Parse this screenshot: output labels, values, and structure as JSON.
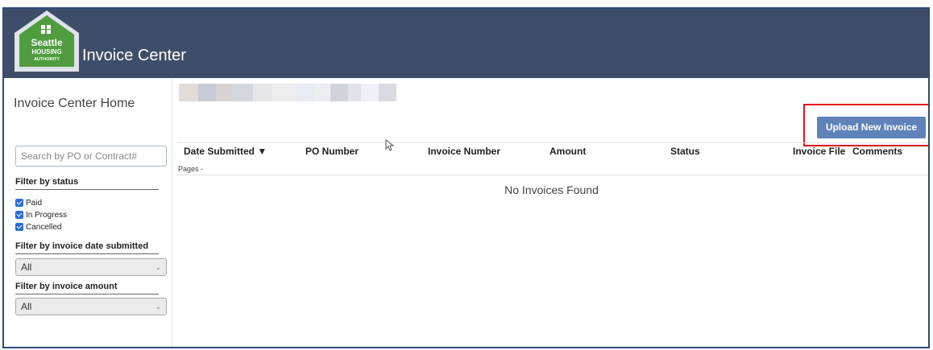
{
  "header": {
    "title": "Invoice Center",
    "logo_lines": [
      "Seattle",
      "HOUSING",
      "AUTHORITY"
    ]
  },
  "sidebar": {
    "home_link": "Invoice Center Home",
    "search_placeholder": "Search by PO or Contract#",
    "status_filter": {
      "heading": "Filter by status",
      "options": [
        {
          "label": "Paid",
          "checked": true
        },
        {
          "label": "In Progress",
          "checked": true
        },
        {
          "label": "Cancelled",
          "checked": true
        }
      ]
    },
    "date_filter": {
      "heading": "Filter by invoice date submitted",
      "value": "All"
    },
    "amount_filter": {
      "heading": "Filter by invoice amount",
      "value": "All"
    }
  },
  "main": {
    "upload_button": "Upload New Invoice",
    "columns": [
      "Date Submitted",
      "PO Number",
      "Invoice Number",
      "Amount",
      "Status",
      "Invoice File",
      "Comments"
    ],
    "sort_indicator": "▼",
    "pages_label": "Pages -",
    "empty_message": "No Invoices Found"
  },
  "colors": {
    "header_bg": "#3f4e68",
    "button_bg": "#5f82b8",
    "highlight": "#e0151b",
    "checkbox": "#2d6ed5",
    "logo_green": "#4f9d3f"
  }
}
